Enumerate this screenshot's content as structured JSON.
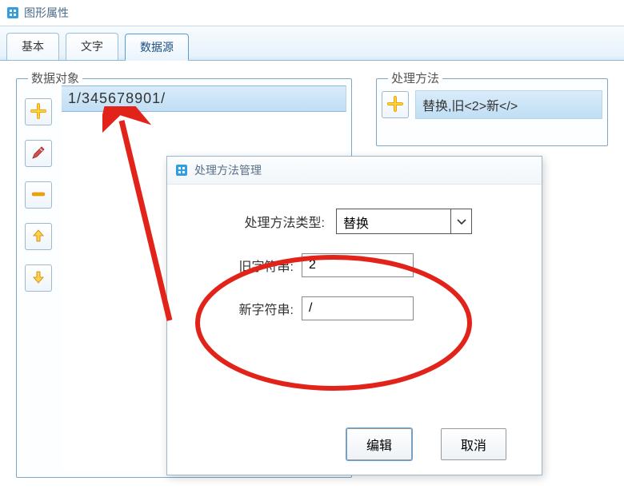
{
  "window": {
    "title": "图形属性"
  },
  "tabs": {
    "basic": "基本",
    "text": "文字",
    "dataSource": "数据源"
  },
  "dataObject": {
    "legend": "数据对象",
    "item": "1/345678901/"
  },
  "method": {
    "legend": "处理方法",
    "item": "替换,旧<2>新</>"
  },
  "dialog": {
    "title": "处理方法管理",
    "typeLabel": "处理方法类型:",
    "typeValue": "替换",
    "oldStrLabel": "旧字符串:",
    "oldStrValue": "2",
    "newStrLabel": "新字符串:",
    "newStrValue": "/",
    "editBtn": "编辑",
    "cancelBtn": "取消"
  }
}
